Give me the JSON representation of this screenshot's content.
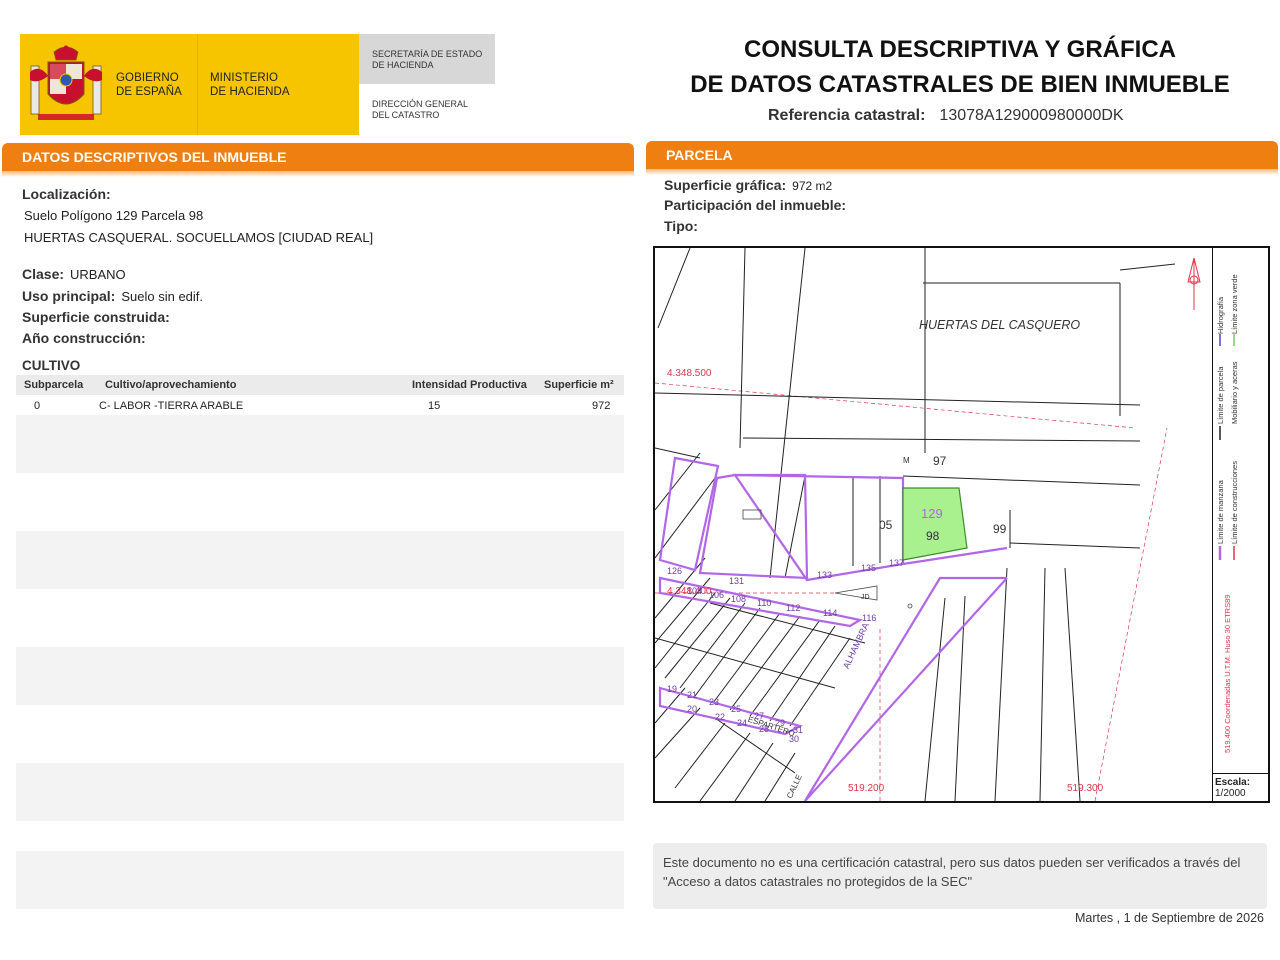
{
  "header": {
    "gov_line1": "GOBIERNO",
    "gov_line2": "DE ESPAÑA",
    "min_line1": "MINISTERIO",
    "min_line2": "DE HACIENDA",
    "secretaria_line1": "SECRETARÍA DE ESTADO",
    "secretaria_line2": "DE HACIENDA",
    "direccion_line1": "DIRECCIÓN GENERAL",
    "direccion_line2": "DEL CATASTRO",
    "colors": {
      "yellow": "#f6c500",
      "red": "#c8102e",
      "gray": "#d7d7d7"
    }
  },
  "title": {
    "line1": "CONSULTA DESCRIPTIVA Y GRÁFICA",
    "line2": "DE DATOS CATASTRALES DE BIEN INMUEBLE",
    "ref_label": "Referencia catastral:",
    "ref_value": "13078A129000980000DK"
  },
  "left": {
    "section_title": "DATOS DESCRIPTIVOS DEL INMUEBLE",
    "localizacion_label": "Localización:",
    "localizacion_line1": "Suelo Polígono 129 Parcela 98",
    "localizacion_line2": "HUERTAS CASQUERAL. SOCUELLAMOS [CIUDAD REAL]",
    "clase_label": "Clase:",
    "clase_value": "URBANO",
    "uso_label": "Uso principal:",
    "uso_value": "Suelo sin edif.",
    "superficie_construida_label": "Superficie construida:",
    "anio_label": "Año construcción:",
    "cultivo": {
      "title": "CULTIVO",
      "headers": [
        "Subparcela",
        "Cultivo/aprovechamiento",
        "Intensidad Productiva",
        "Superficie m²"
      ],
      "rows": [
        [
          "0",
          "C- LABOR -TIERRA ARABLE",
          "15",
          "972"
        ]
      ]
    }
  },
  "right": {
    "section_title": "PARCELA",
    "superficie_grafica_label": "Superficie gráfica:",
    "superficie_grafica_value": "972 m2",
    "participacion_label": "Participación del inmueble:",
    "tipo_label": "Tipo:",
    "map": {
      "area_label": "HUERTAS DEL CASQUERO",
      "coord_top": "4.348.500",
      "coord_mid": "4.348.400",
      "coord_x1": "519.200",
      "coord_x2": "519.300",
      "parcel_poligono": "129",
      "parcel_number": "98",
      "neighbour_97": "97",
      "neighbour_99": "99",
      "neighbour_05": "05",
      "parcel_marker_m": "M",
      "marker_jd": "JD",
      "street_alhambra": "ALHAMBRA",
      "street_calle": "CALLE",
      "street_esparte": "ESPARTERO",
      "lot_numbers_row1": [
        "126",
        "131",
        "133",
        "135",
        "137"
      ],
      "lot_numbers_row2": [
        "104",
        "106",
        "108",
        "110",
        "112",
        "114",
        "116"
      ],
      "lot_numbers_row3": [
        "19",
        "21",
        "23",
        "25",
        "27",
        "29",
        "31"
      ],
      "lot_numbers_row4": [
        "20",
        "22",
        "24",
        "28",
        "30"
      ],
      "colors": {
        "parcel_fill": "#a9f08f",
        "parcel_stroke": "#3a8f2a",
        "block_stroke": "#b266e8",
        "coord": "#e0364a",
        "grid": "#222222"
      }
    },
    "legend": {
      "hidrografia": "Hidrografía",
      "limite_zona_verde": "Límite zona verde",
      "limite_parcela": "Límite de parcela",
      "mobiliario": "Mobiliario y aceras",
      "limite_manzana": "Límite de manzana",
      "limite_construcciones": "Límite de construcciones",
      "coordenadas": "519.400 Coordenadas U.T.M. Huso 30 ETRS89"
    },
    "scale_label": "Escala:",
    "scale_value": "1/2000",
    "notice": "Este documento no es una certificación catastral, pero sus datos pueden ser verificados a través del \"Acceso a datos catastrales no protegidos de la SEC\"",
    "date": "Martes , 1 de Septiembre de 2026"
  }
}
